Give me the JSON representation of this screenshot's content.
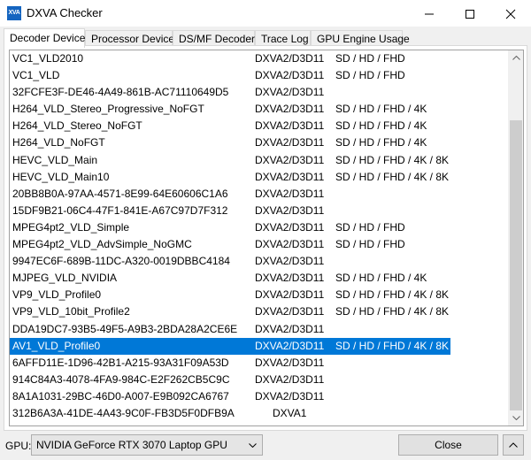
{
  "window": {
    "title": "DXVA Checker",
    "icon_text": "XVA",
    "icon_color": "#1565c0"
  },
  "tabs": [
    {
      "label": "Decoder Device",
      "active": true
    },
    {
      "label": "Processor Device",
      "active": false
    },
    {
      "label": "DS/MF Decoder",
      "active": false
    },
    {
      "label": "Trace Log",
      "active": false
    },
    {
      "label": "GPU Engine Usage",
      "active": false
    }
  ],
  "decoders": [
    {
      "name": "VC1_VLD2010",
      "api": "DXVA2/D3D11",
      "res": "SD / HD / FHD"
    },
    {
      "name": "VC1_VLD",
      "api": "DXVA2/D3D11",
      "res": "SD / HD / FHD"
    },
    {
      "name": "32FCFE3F-DE46-4A49-861B-AC71110649D5",
      "api": "DXVA2/D3D11",
      "res": ""
    },
    {
      "name": "H264_VLD_Stereo_Progressive_NoFGT",
      "api": "DXVA2/D3D11",
      "res": "SD / HD / FHD / 4K"
    },
    {
      "name": "H264_VLD_Stereo_NoFGT",
      "api": "DXVA2/D3D11",
      "res": "SD / HD / FHD / 4K"
    },
    {
      "name": "H264_VLD_NoFGT",
      "api": "DXVA2/D3D11",
      "res": "SD / HD / FHD / 4K"
    },
    {
      "name": "HEVC_VLD_Main",
      "api": "DXVA2/D3D11",
      "res": "SD / HD / FHD / 4K / 8K"
    },
    {
      "name": "HEVC_VLD_Main10",
      "api": "DXVA2/D3D11",
      "res": "SD / HD / FHD / 4K / 8K"
    },
    {
      "name": "20BB8B0A-97AA-4571-8E99-64E60606C1A6",
      "api": "DXVA2/D3D11",
      "res": ""
    },
    {
      "name": "15DF9B21-06C4-47F1-841E-A67C97D7F312",
      "api": "DXVA2/D3D11",
      "res": ""
    },
    {
      "name": "MPEG4pt2_VLD_Simple",
      "api": "DXVA2/D3D11",
      "res": "SD / HD / FHD"
    },
    {
      "name": "MPEG4pt2_VLD_AdvSimple_NoGMC",
      "api": "DXVA2/D3D11",
      "res": "SD / HD / FHD"
    },
    {
      "name": "9947EC6F-689B-11DC-A320-0019DBBC4184",
      "api": "DXVA2/D3D11",
      "res": ""
    },
    {
      "name": "MJPEG_VLD_NVIDIA",
      "api": "DXVA2/D3D11",
      "res": "SD / HD / FHD / 4K"
    },
    {
      "name": "VP9_VLD_Profile0",
      "api": "DXVA2/D3D11",
      "res": "SD / HD / FHD / 4K / 8K"
    },
    {
      "name": "VP9_VLD_10bit_Profile2",
      "api": "DXVA2/D3D11",
      "res": "SD / HD / FHD / 4K / 8K"
    },
    {
      "name": "DDA19DC7-93B5-49F5-A9B3-2BDA28A2CE6E",
      "api": "DXVA2/D3D11",
      "res": ""
    },
    {
      "name": "AV1_VLD_Profile0",
      "api": "DXVA2/D3D11",
      "res": "SD / HD / FHD / 4K / 8K",
      "selected": true
    },
    {
      "name": "6AFFD11E-1D96-42B1-A215-93A31F09A53D",
      "api": "DXVA2/D3D11",
      "res": ""
    },
    {
      "name": "914C84A3-4078-4FA9-984C-E2F262CB5C9C",
      "api": "DXVA2/D3D11",
      "res": ""
    },
    {
      "name": "8A1A1031-29BC-46D0-A007-E9B092CA6767",
      "api": "DXVA2/D3D11",
      "res": ""
    },
    {
      "name": "312B6A3A-41DE-4A43-9C0F-FB3D5F0DFB9A",
      "api": "DXVA1",
      "res": ""
    }
  ],
  "footer": {
    "gpu_label": "GPU:",
    "gpu_value": "NVIDIA GeForce RTX 3070 Laptop GPU",
    "close_label": "Close"
  },
  "colors": {
    "selection": "#0078d7",
    "window_bg": "#f0f0f0"
  }
}
